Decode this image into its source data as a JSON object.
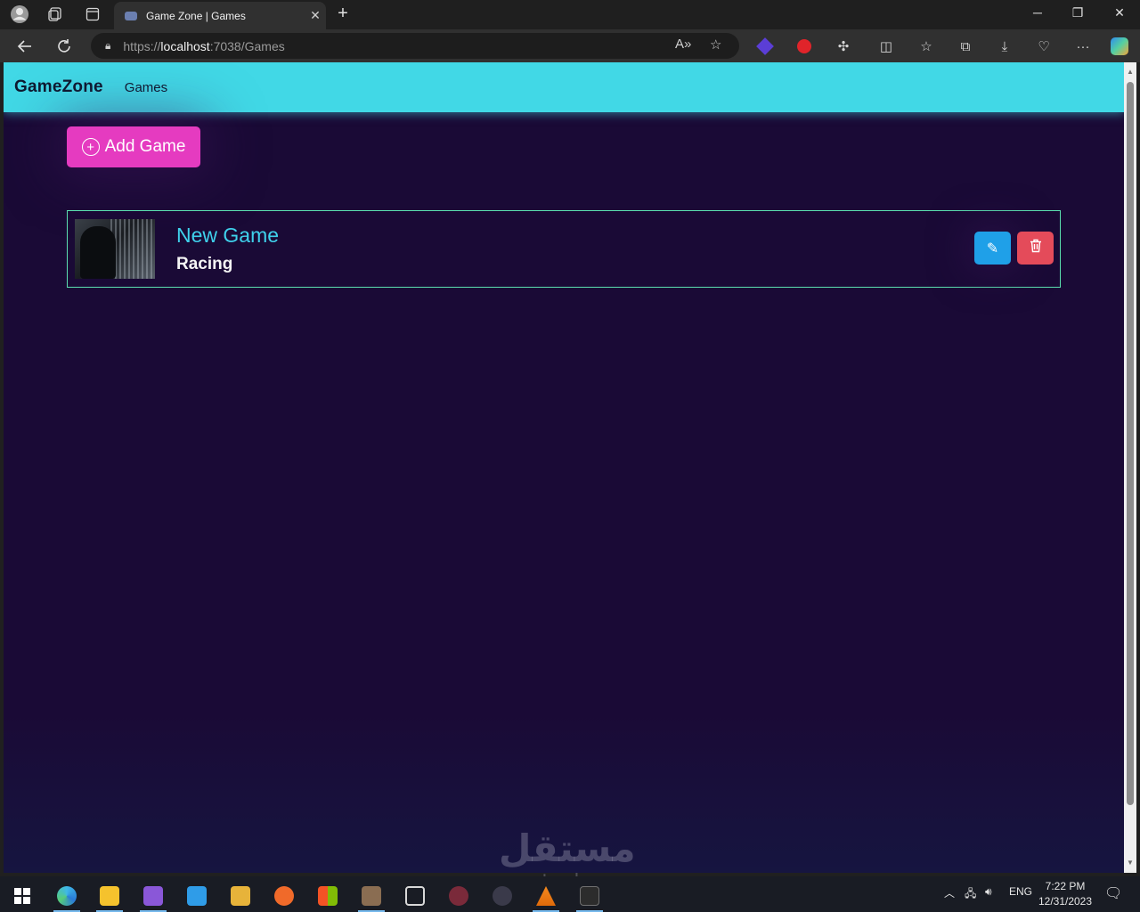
{
  "browser": {
    "tab_title": "Game Zone | Games",
    "url_protocol": "https://",
    "url_host": "localhost",
    "url_rest": ":7038/Games"
  },
  "site": {
    "brand": "GameZone",
    "nav_games": "Games",
    "add_button_label": "Add Game",
    "add_button_icon": "+"
  },
  "games": [
    {
      "name": "New Game",
      "category": "Racing"
    }
  ],
  "watermark": {
    "arabic": "مستقل",
    "latin": "mostaql.com"
  },
  "taskbar": {
    "lang": "ENG",
    "time": "7:22 PM",
    "date": "12/31/2023"
  },
  "colors": {
    "navbar": "#41d8e6",
    "page_bg": "#1a0a36",
    "add_button": "#e53bc0",
    "edit_button": "#1fa0e8",
    "delete_button": "#e44b5a",
    "game_title": "#3fd1ec",
    "card_border": "#5be0b0"
  }
}
